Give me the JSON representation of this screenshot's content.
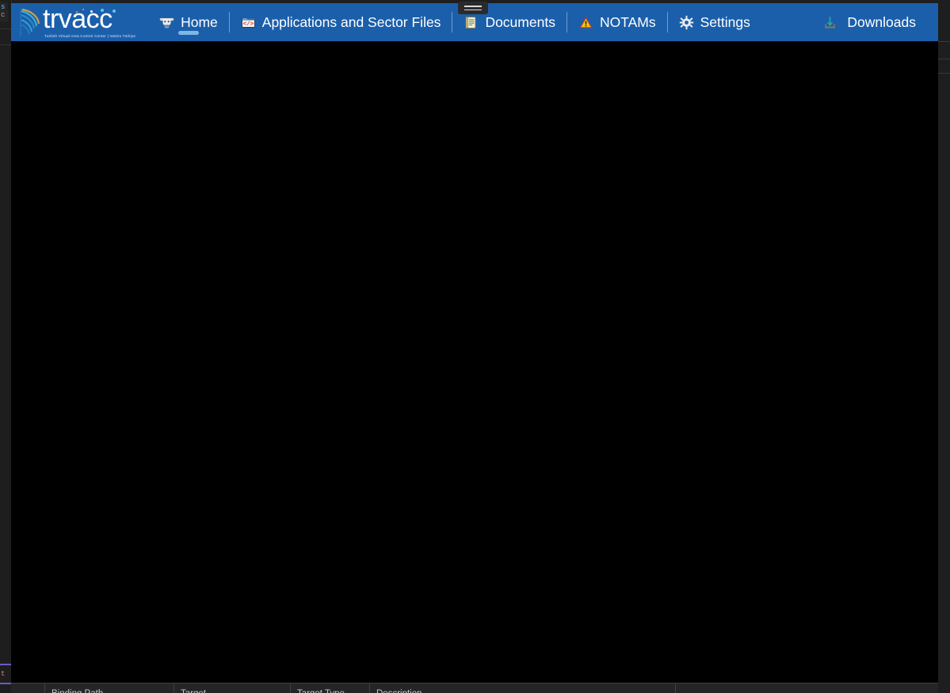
{
  "window": {
    "app_title": "trvacc",
    "background_color": "#000000",
    "nav_background_color": "#1b5fab",
    "accent_color": "#7db7e8",
    "ide_chrome_color": "#1e1e1e"
  },
  "brand": {
    "wordmark": "trvacc",
    "tagline": "Turkish Virtual Area Control Center | Vatsim Türkiye",
    "logo_icon": "trvacc-swoosh-logo"
  },
  "nav": {
    "items": [
      {
        "id": "home",
        "label": "Home",
        "icon": "cow-head-icon",
        "active": true
      },
      {
        "id": "applications",
        "label": "Applications and Sector Files",
        "icon": "code-window-icon",
        "active": false
      },
      {
        "id": "documents",
        "label": "Documents",
        "icon": "document-notepad-icon",
        "active": false
      },
      {
        "id": "notams",
        "label": "NOTAMs",
        "icon": "warning-triangle-icon",
        "active": false
      },
      {
        "id": "settings",
        "label": "Settings",
        "icon": "gear-icon",
        "active": false
      }
    ],
    "right": {
      "label": "Downloads",
      "icon": "download-arrow-icon"
    }
  },
  "overlay": {
    "handle_name": "drag-handle-overlay",
    "lines": 2
  },
  "binding_panel": {
    "columns": [
      "Binding Path",
      "Target",
      "Target Type",
      "Description",
      ""
    ]
  }
}
